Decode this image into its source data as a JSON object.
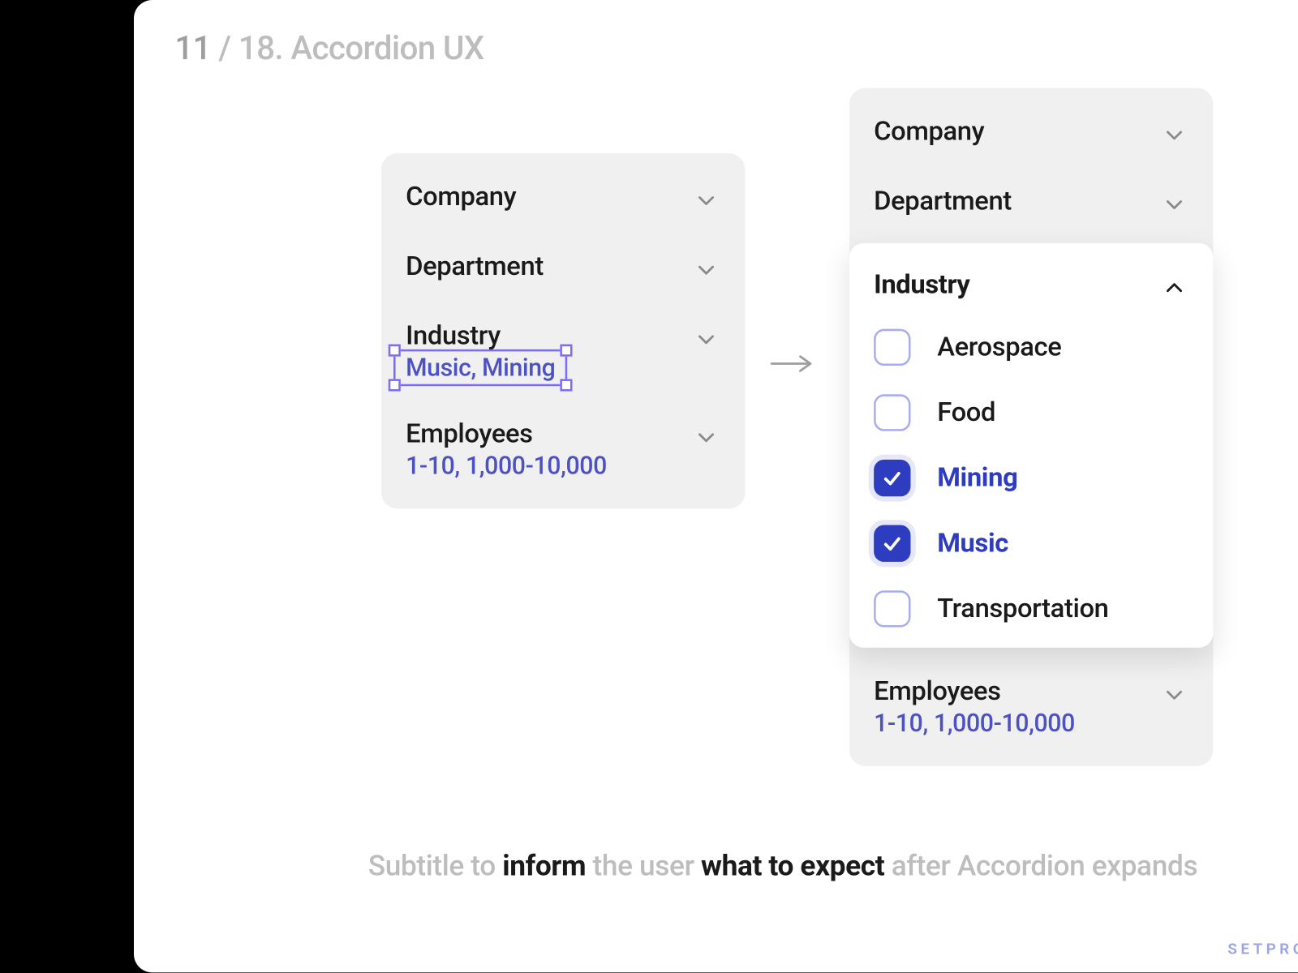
{
  "page": {
    "number": "11",
    "total_and_title": "/ 18. Accordion UX"
  },
  "left_panel": {
    "rows": [
      {
        "label": "Company",
        "sub": ""
      },
      {
        "label": "Department",
        "sub": ""
      },
      {
        "label": "Industry",
        "sub": "Music, Mining"
      },
      {
        "label": "Employees",
        "sub": "1-10, 1,000-10,000"
      }
    ]
  },
  "right_panel": {
    "rows_top": [
      {
        "label": "Company",
        "sub": ""
      },
      {
        "label": "Department",
        "sub": ""
      }
    ],
    "expanded": {
      "label": "Industry",
      "options": [
        {
          "label": "Aerospace",
          "checked": false
        },
        {
          "label": "Food",
          "checked": false
        },
        {
          "label": "Mining",
          "checked": true
        },
        {
          "label": "Music",
          "checked": true
        },
        {
          "label": "Transportation",
          "checked": false
        }
      ]
    },
    "rows_bottom": [
      {
        "label": "Employees",
        "sub": "1-10, 1,000-10,000"
      }
    ]
  },
  "caption": {
    "p1": "Subtitle to ",
    "em1": "inform",
    "p2": " the user ",
    "em2": "what to expect",
    "p3": " after Accordion expands"
  },
  "watermark": "SETPRODUCT.COM"
}
